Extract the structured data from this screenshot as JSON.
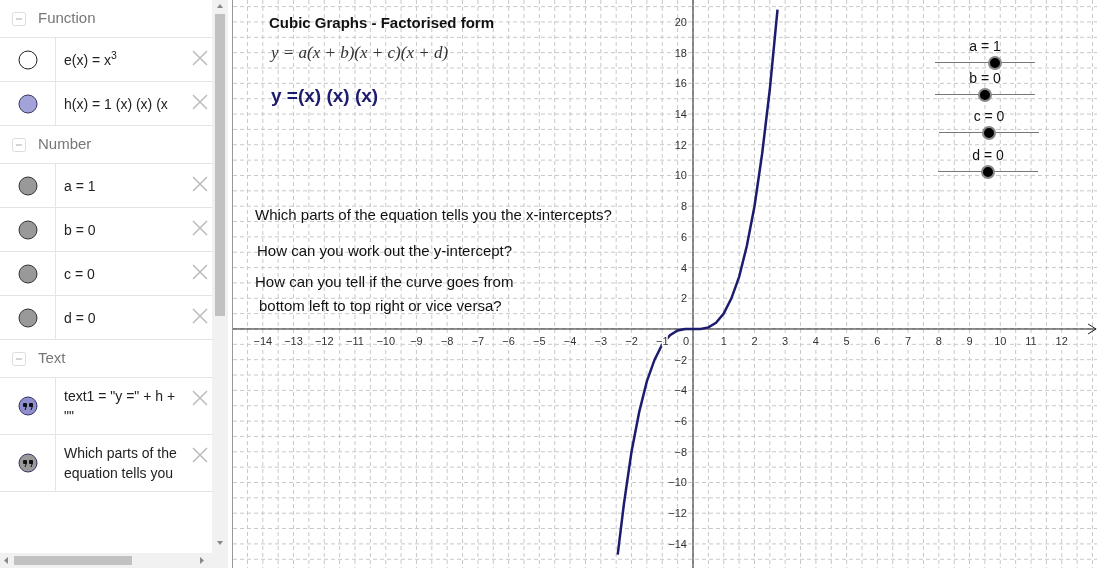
{
  "algebra": {
    "sections": [
      {
        "title": "Function",
        "expanded": true,
        "items": [
          {
            "kind": "function",
            "visible": false,
            "text": "e(x) = x$^{3}$"
          },
          {
            "kind": "function",
            "visible": true,
            "color": "#a3a3d9",
            "text": "h(x) = 1 (x) (x) (x"
          }
        ]
      },
      {
        "title": "Number",
        "expanded": true,
        "items": [
          {
            "kind": "number",
            "visible": true,
            "color": "#999999",
            "text": "a = 1"
          },
          {
            "kind": "number",
            "visible": true,
            "color": "#999999",
            "text": "b = 0"
          },
          {
            "kind": "number",
            "visible": true,
            "color": "#999999",
            "text": "c = 0"
          },
          {
            "kind": "number",
            "visible": true,
            "color": "#999999",
            "text": "d = 0"
          }
        ]
      },
      {
        "title": "Text",
        "expanded": true,
        "items": [
          {
            "kind": "text",
            "visible": true,
            "color": "#8f8fcf",
            "text": "text1 = \"y =\" + h + \"\""
          },
          {
            "kind": "text",
            "visible": true,
            "color": "#999999",
            "text": "Which parts of the equation tells you"
          }
        ]
      }
    ]
  },
  "graphics": {
    "texts": [
      {
        "kind": "title",
        "text": "Cubic Graphs - Factorised form"
      },
      {
        "kind": "formula",
        "text": "y = a(x + b)(x + c)(x + d)"
      },
      {
        "kind": "equation",
        "text": "y =(x) (x) (x)"
      },
      {
        "kind": "question",
        "text": "Which parts of the equation tells you the x-intercepts?"
      },
      {
        "kind": "question",
        "text": "How can you work out the y-intercept?"
      },
      {
        "kind": "question",
        "text": "How can you tell if the curve goes from"
      },
      {
        "kind": "question",
        "text": "bottom left to top right or vice versa?"
      }
    ],
    "sliders": [
      {
        "label": "a = 1",
        "level": 0.6
      },
      {
        "label": "b = 0",
        "level": 0.5
      },
      {
        "label": "c = 0",
        "level": 0.5
      },
      {
        "label": "d = 0",
        "level": 0.5
      }
    ],
    "origin_label": "0",
    "chart_data": {
      "type": "line",
      "grid": true,
      "xlim": [
        -14.97,
        13.18
      ],
      "ylim": [
        -15.57,
        21.43
      ],
      "x": [
        -2.45,
        -2.25,
        -2,
        -1.75,
        -1.5,
        -1.25,
        -1,
        -0.75,
        -0.5,
        -0.25,
        0,
        0.25,
        0.5,
        0.75,
        1,
        1.25,
        1.5,
        1.75,
        2,
        2.25,
        2.5,
        2.75
      ],
      "series": [
        {
          "color": "#1c1c6e",
          "values": [
            -14.7,
            -11.4,
            -8,
            -5.4,
            -3.4,
            -2,
            -1,
            -0.4,
            -0.1,
            0,
            0,
            0,
            0.1,
            0.4,
            1,
            2,
            3.4,
            5.4,
            8,
            11.4,
            15.6,
            20.8
          ]
        }
      ],
      "xticks": [
        {
          "value": -14,
          "label": "−14"
        },
        {
          "value": -13,
          "label": "−13"
        },
        {
          "value": -12,
          "label": "−12"
        },
        {
          "value": -11,
          "label": "−11"
        },
        {
          "value": -10,
          "label": "−10"
        },
        {
          "value": -9,
          "label": "−9"
        },
        {
          "value": -8,
          "label": "−8"
        },
        {
          "value": -7,
          "label": "−7"
        },
        {
          "value": -6,
          "label": "−6"
        },
        {
          "value": -5,
          "label": "−5"
        },
        {
          "value": -4,
          "label": "−4"
        },
        {
          "value": -3,
          "label": "−3"
        },
        {
          "value": -2,
          "label": "−2"
        },
        {
          "value": -1,
          "label": "−1"
        },
        1,
        2,
        3,
        4,
        5,
        6,
        7,
        8,
        9,
        10,
        11,
        12
      ],
      "yticks": [
        20,
        18,
        16,
        14,
        12,
        10,
        8,
        6,
        4,
        2,
        {
          "value": -2,
          "label": "−2"
        },
        {
          "value": -4,
          "label": "−4"
        },
        {
          "value": -6,
          "label": "−6"
        },
        {
          "value": -8,
          "label": "−8"
        },
        {
          "value": -10,
          "label": "−10"
        },
        {
          "value": -12,
          "label": "−12"
        },
        {
          "value": -14,
          "label": "−14"
        }
      ]
    }
  }
}
